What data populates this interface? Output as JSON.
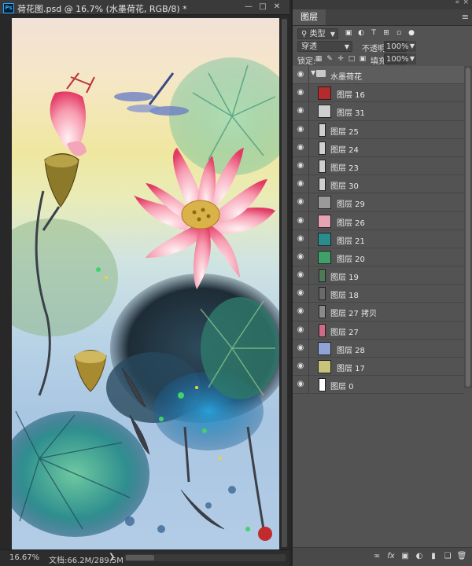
{
  "document": {
    "title": "荷花图.psd @ 16.7% (水墨荷花, RGB/8) *",
    "app_icon": "Ps",
    "zoom": "16.67%",
    "doc_size": "文档:66.2M/289.5M",
    "window_buttons": [
      "minimize-icon",
      "maximize-icon",
      "close-icon"
    ]
  },
  "layers_panel": {
    "tab_label": "图层",
    "filter_kind": "类型",
    "blend_mode": "穿透",
    "opacity_label": "不透明度:",
    "opacity_value": "100%",
    "lock_label": "锁定:",
    "fill_label": "填充:",
    "fill_value": "100%",
    "group": {
      "name": "水墨荷花",
      "expanded": true
    },
    "layers": [
      {
        "name": "图层 16",
        "thumb_color": "#b52a2a"
      },
      {
        "name": "图层 31",
        "thumb_color": "#cfcfcf"
      },
      {
        "name": "图层 25",
        "thumb_color": "#cfcfcf"
      },
      {
        "name": "图层 24",
        "thumb_color": "#cfcfcf"
      },
      {
        "name": "图层 23",
        "thumb_color": "#cfcfcf"
      },
      {
        "name": "图层 30",
        "thumb_color": "#cfcfcf"
      },
      {
        "name": "图层 29",
        "thumb_color": "#9a9a9a"
      },
      {
        "name": "图层 26",
        "thumb_color": "#e6a3b4"
      },
      {
        "name": "图层 21",
        "thumb_color": "#2a8c8c"
      },
      {
        "name": "图层 20",
        "thumb_color": "#3fa06a"
      },
      {
        "name": "图层 19",
        "thumb_color": "#4e7a58"
      },
      {
        "name": "图层 18",
        "thumb_color": "#6a6a6a"
      },
      {
        "name": "图层 27 拷贝",
        "thumb_color": "#8a8a8a"
      },
      {
        "name": "图层 27",
        "thumb_color": "#d06a86"
      },
      {
        "name": "图层 28",
        "thumb_color": "#8fa3d6"
      },
      {
        "name": "图层 17",
        "thumb_color": "#c9c27a"
      },
      {
        "name": "图层 0",
        "thumb_color": "#ffffff"
      }
    ]
  }
}
